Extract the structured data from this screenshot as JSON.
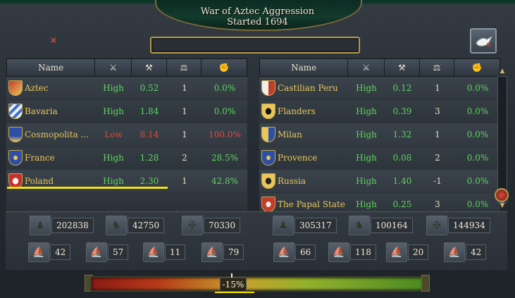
{
  "war": {
    "title": "War of Aztec Aggression",
    "started": "Started 1694"
  },
  "close_symbol": "×",
  "peace_icon": "dove-icon",
  "headers": {
    "name": "Name",
    "morale_icon": "crossed-swords-icon",
    "strength_icon": "crossed-hammers-icon",
    "war_icon": "scales-icon",
    "score_icon": "participation-icon"
  },
  "attackers": [
    {
      "name": "Aztec",
      "morale": "High",
      "strength": "0.52",
      "war": "1",
      "score": "0.0%"
    },
    {
      "name": "Bavaria",
      "morale": "High",
      "strength": "1.84",
      "war": "1",
      "score": "0.0%"
    },
    {
      "name": "Cosmopolita ...",
      "morale": "Low",
      "strength": "8.14",
      "war": "1",
      "score": "100.0%"
    },
    {
      "name": "France",
      "morale": "High",
      "strength": "1.28",
      "war": "2",
      "score": "28.5%"
    },
    {
      "name": "Poland",
      "morale": "High",
      "strength": "2.30",
      "war": "1",
      "score": "42.8%"
    }
  ],
  "defenders": [
    {
      "name": "Castilian Peru",
      "morale": "High",
      "strength": "0.12",
      "war": "1",
      "score": "0.0%"
    },
    {
      "name": "Flanders",
      "morale": "High",
      "strength": "0.39",
      "war": "3",
      "score": "0.0%"
    },
    {
      "name": "Milan",
      "morale": "High",
      "strength": "1.32",
      "war": "1",
      "score": "0.0%"
    },
    {
      "name": "Provence",
      "morale": "High",
      "strength": "0.08",
      "war": "2",
      "score": "0.0%"
    },
    {
      "name": "Russia",
      "morale": "High",
      "strength": "1.40",
      "war": "-1",
      "score": "0.0%"
    },
    {
      "name": "The Papal State",
      "morale": "High",
      "strength": "0.25",
      "war": "3",
      "score": "0.0%"
    }
  ],
  "attacker_units": {
    "infantry": "202838",
    "cavalry": "42750",
    "artillery": "70330",
    "heavy_ships": "42",
    "light_ships": "57",
    "galleys": "11",
    "transports": "79"
  },
  "defender_units": {
    "infantry": "305317",
    "cavalry": "100164",
    "artillery": "144934",
    "heavy_ships": "66",
    "light_ships": "118",
    "galleys": "20",
    "transports": "42"
  },
  "war_balance": {
    "label": "-15%",
    "value": -15
  },
  "colors": {
    "high": "#5fd45f",
    "low": "#e24a3a",
    "highlight": "#f5e600",
    "gold": "#e8c65a"
  }
}
